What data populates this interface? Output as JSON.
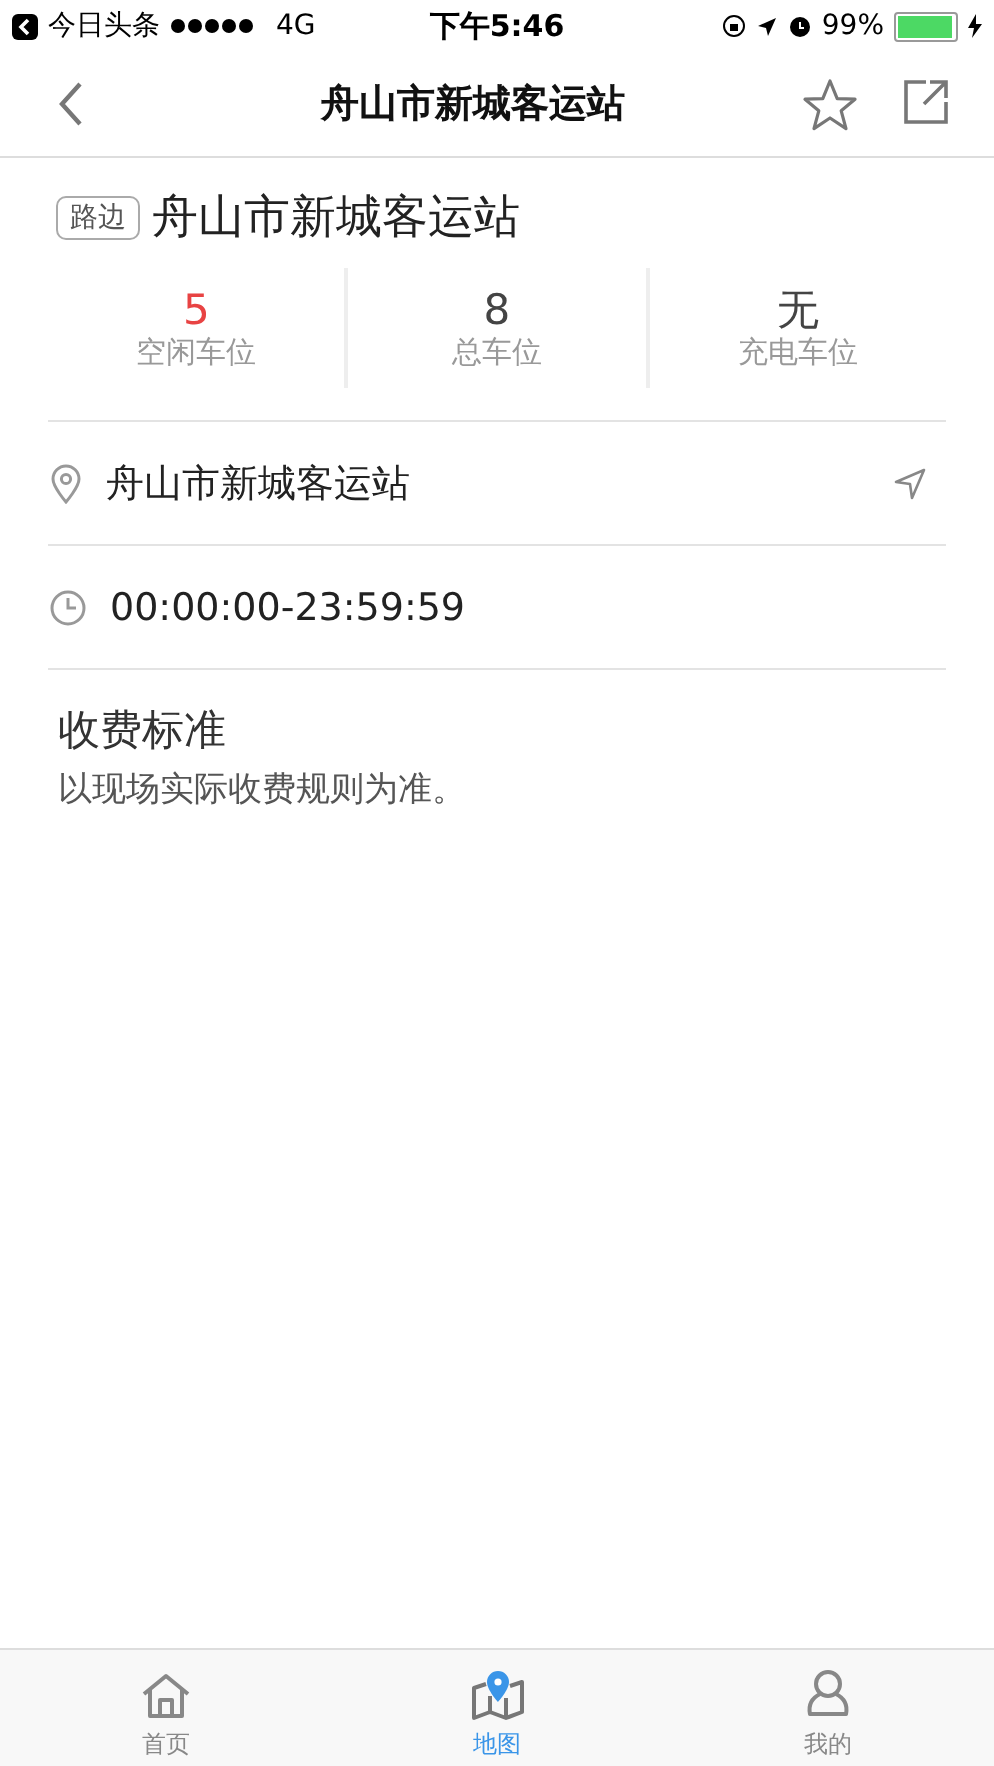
{
  "status_bar": {
    "back_app": "今日头条",
    "network": "4G",
    "time": "下午5:46",
    "battery": "99%"
  },
  "nav": {
    "title": "舟山市新城客运站"
  },
  "header": {
    "tag": "路边",
    "name": "舟山市新城客运站"
  },
  "stats": [
    {
      "value": "5",
      "label": "空闲车位",
      "color": "#e84343"
    },
    {
      "value": "8",
      "label": "总车位",
      "color": "#444444"
    },
    {
      "value": "无",
      "label": "充电车位",
      "color": "#444444"
    }
  ],
  "info_rows": [
    {
      "kind": "address",
      "text": "舟山市新城客运站"
    },
    {
      "kind": "hours",
      "text": "00:00:00-23:59:59"
    }
  ],
  "fee": {
    "title": "收费标准",
    "text": "以现场实际收费规则为准。"
  },
  "tabs": [
    {
      "label": "首页",
      "kind": "home",
      "selected": false
    },
    {
      "label": "地图",
      "kind": "map",
      "selected": true
    },
    {
      "label": "我的",
      "kind": "user",
      "selected": false
    }
  ]
}
